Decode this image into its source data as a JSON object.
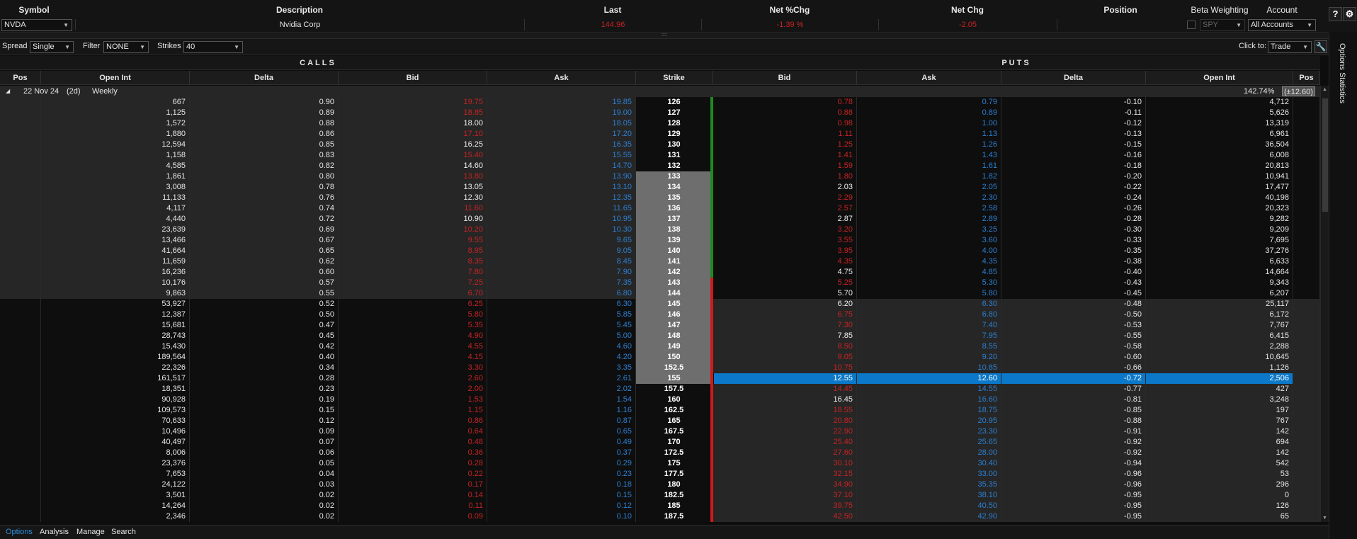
{
  "quote": {
    "headers": {
      "symbol": "Symbol",
      "description": "Description",
      "last": "Last",
      "net_pct": "Net %Chg",
      "net_chg": "Net Chg",
      "position": "Position",
      "beta": "Beta Weighting",
      "account": "Account"
    },
    "symbol": "NVDA",
    "description": "Nvidia Corp",
    "last": "144.96",
    "net_pct": "-1.39 %",
    "net_chg": "-2.05",
    "position": "",
    "beta_symbol": "SPY",
    "account": "All Accounts"
  },
  "buttons": {
    "help": "?",
    "settings": "⚙"
  },
  "splitter": "::::",
  "controls": {
    "spread_label": "Spread",
    "spread_value": "Single",
    "filter_label": "Filter",
    "filter_value": "NONE",
    "strikes_label": "Strikes",
    "strikes_value": "40",
    "clickto_label": "Click to:",
    "clickto_value": "Trade"
  },
  "sections": {
    "calls": "CALLS",
    "puts": "PUTS"
  },
  "columns": {
    "pos": "Pos",
    "open_int": "Open Int",
    "delta": "Delta",
    "bid": "Bid",
    "ask": "Ask",
    "strike": "Strike",
    "p_bid": "Bid",
    "p_ask": "Ask",
    "p_delta": "Delta",
    "p_open_int": "Open Int",
    "p_pos": "Pos"
  },
  "expiration": {
    "date": "22 Nov 24",
    "days": "(2d)",
    "type": "Weekly",
    "iv": "142.74%",
    "move": "(±12.60)"
  },
  "colors": {
    "call_bid_red": "#c62323",
    "ask_blue": "#2c7fd0",
    "selected_row": "#0b78c9",
    "itm_bg": "#1e1e1e"
  },
  "rows": [
    {
      "coi": "667",
      "cdelta": "0.90",
      "cbid": "19.75",
      "cbidc": "red",
      "cask": "19.85",
      "strike": "126",
      "pbid": "0.78",
      "pbidc": "red",
      "pask": "0.79",
      "pdelta": "-0.10",
      "poi": "4,712"
    },
    {
      "coi": "1,125",
      "cdelta": "0.89",
      "cbid": "18.85",
      "cbidc": "red",
      "cask": "19.00",
      "strike": "127",
      "pbid": "0.88",
      "pbidc": "red",
      "pask": "0.89",
      "pdelta": "-0.11",
      "poi": "5,626"
    },
    {
      "coi": "1,572",
      "cdelta": "0.88",
      "cbid": "18.00",
      "cbidc": "white",
      "cask": "18.05",
      "strike": "128",
      "pbid": "0.98",
      "pbidc": "red",
      "pask": "1.00",
      "pdelta": "-0.12",
      "poi": "13,319"
    },
    {
      "coi": "1,880",
      "cdelta": "0.86",
      "cbid": "17.10",
      "cbidc": "red",
      "cask": "17.20",
      "strike": "129",
      "pbid": "1.11",
      "pbidc": "red",
      "pask": "1.13",
      "pdelta": "-0.13",
      "poi": "6,961"
    },
    {
      "coi": "12,594",
      "cdelta": "0.85",
      "cbid": "16.25",
      "cbidc": "white",
      "cask": "16.35",
      "strike": "130",
      "pbid": "1.25",
      "pbidc": "red",
      "pask": "1.26",
      "pdelta": "-0.15",
      "poi": "36,504"
    },
    {
      "coi": "1,158",
      "cdelta": "0.83",
      "cbid": "15.40",
      "cbidc": "red",
      "cask": "15.55",
      "strike": "131",
      "pbid": "1.41",
      "pbidc": "red",
      "pask": "1.43",
      "pdelta": "-0.16",
      "poi": "6,008"
    },
    {
      "coi": "4,585",
      "cdelta": "0.82",
      "cbid": "14.60",
      "cbidc": "white",
      "cask": "14.70",
      "strike": "132",
      "pbid": "1.59",
      "pbidc": "red",
      "pask": "1.61",
      "pdelta": "-0.18",
      "poi": "20,813"
    },
    {
      "coi": "1,861",
      "cdelta": "0.80",
      "cbid": "13.80",
      "cbidc": "red",
      "cask": "13.90",
      "strike": "133",
      "pbid": "1.80",
      "pbidc": "red",
      "pask": "1.82",
      "pdelta": "-0.20",
      "poi": "10,941"
    },
    {
      "coi": "3,008",
      "cdelta": "0.78",
      "cbid": "13.05",
      "cbidc": "white",
      "cask": "13.10",
      "strike": "134",
      "pbid": "2.03",
      "pbidc": "white",
      "pask": "2.05",
      "pdelta": "-0.22",
      "poi": "17,477"
    },
    {
      "coi": "11,133",
      "cdelta": "0.76",
      "cbid": "12.30",
      "cbidc": "white",
      "cask": "12.35",
      "strike": "135",
      "pbid": "2.29",
      "pbidc": "red",
      "pask": "2.30",
      "pdelta": "-0.24",
      "poi": "40,198"
    },
    {
      "coi": "4,117",
      "cdelta": "0.74",
      "cbid": "11.60",
      "cbidc": "red",
      "cask": "11.65",
      "strike": "136",
      "pbid": "2.57",
      "pbidc": "red",
      "pask": "2.58",
      "pdelta": "-0.26",
      "poi": "20,323"
    },
    {
      "coi": "4,440",
      "cdelta": "0.72",
      "cbid": "10.90",
      "cbidc": "white",
      "cask": "10.95",
      "strike": "137",
      "pbid": "2.87",
      "pbidc": "white",
      "pask": "2.89",
      "pdelta": "-0.28",
      "poi": "9,282"
    },
    {
      "coi": "23,639",
      "cdelta": "0.69",
      "cbid": "10.20",
      "cbidc": "red",
      "cask": "10.30",
      "strike": "138",
      "pbid": "3.20",
      "pbidc": "red",
      "pask": "3.25",
      "pdelta": "-0.30",
      "poi": "9,209"
    },
    {
      "coi": "13,466",
      "cdelta": "0.67",
      "cbid": "9.55",
      "cbidc": "red",
      "cask": "9.65",
      "strike": "139",
      "pbid": "3.55",
      "pbidc": "red",
      "pask": "3.60",
      "pdelta": "-0.33",
      "poi": "7,695"
    },
    {
      "coi": "41,664",
      "cdelta": "0.65",
      "cbid": "8.95",
      "cbidc": "red",
      "cask": "9.05",
      "strike": "140",
      "pbid": "3.95",
      "pbidc": "red",
      "pask": "4.00",
      "pdelta": "-0.35",
      "poi": "37,276"
    },
    {
      "coi": "11,659",
      "cdelta": "0.62",
      "cbid": "8.35",
      "cbidc": "red",
      "cask": "8.45",
      "strike": "141",
      "pbid": "4.35",
      "pbidc": "red",
      "pask": "4.35",
      "pdelta": "-0.38",
      "poi": "6,633"
    },
    {
      "coi": "16,236",
      "cdelta": "0.60",
      "cbid": "7.80",
      "cbidc": "red",
      "cask": "7.90",
      "strike": "142",
      "pbid": "4.75",
      "pbidc": "white",
      "pask": "4.85",
      "pdelta": "-0.40",
      "poi": "14,664"
    },
    {
      "coi": "10,176",
      "cdelta": "0.57",
      "cbid": "7.25",
      "cbidc": "red",
      "cask": "7.35",
      "strike": "143",
      "pbid": "5.25",
      "pbidc": "red",
      "pask": "5.30",
      "pdelta": "-0.43",
      "poi": "9,343"
    },
    {
      "coi": "9,863",
      "cdelta": "0.55",
      "cbid": "6.70",
      "cbidc": "red",
      "cask": "6.80",
      "strike": "144",
      "pbid": "5.70",
      "pbidc": "white",
      "pask": "5.80",
      "pdelta": "-0.45",
      "poi": "6,207"
    },
    {
      "coi": "53,927",
      "cdelta": "0.52",
      "cbid": "6.25",
      "cbidc": "red",
      "cask": "6.30",
      "strike": "145",
      "pbid": "6.20",
      "pbidc": "white",
      "pask": "6.30",
      "pdelta": "-0.48",
      "poi": "25,117"
    },
    {
      "coi": "12,387",
      "cdelta": "0.50",
      "cbid": "5.80",
      "cbidc": "red",
      "cask": "5.85",
      "strike": "146",
      "pbid": "6.75",
      "pbidc": "red",
      "pask": "6.80",
      "pdelta": "-0.50",
      "poi": "6,172"
    },
    {
      "coi": "15,681",
      "cdelta": "0.47",
      "cbid": "5.35",
      "cbidc": "red",
      "cask": "5.45",
      "strike": "147",
      "pbid": "7.30",
      "pbidc": "red",
      "pask": "7.40",
      "pdelta": "-0.53",
      "poi": "7,767"
    },
    {
      "coi": "28,743",
      "cdelta": "0.45",
      "cbid": "4.90",
      "cbidc": "red",
      "cask": "5.00",
      "strike": "148",
      "pbid": "7.85",
      "pbidc": "white",
      "pask": "7.95",
      "pdelta": "-0.55",
      "poi": "6,415"
    },
    {
      "coi": "15,430",
      "cdelta": "0.42",
      "cbid": "4.55",
      "cbidc": "red",
      "cask": "4.60",
      "strike": "149",
      "pbid": "8.50",
      "pbidc": "red",
      "pask": "8.55",
      "pdelta": "-0.58",
      "poi": "2,288"
    },
    {
      "coi": "189,564",
      "cdelta": "0.40",
      "cbid": "4.15",
      "cbidc": "red",
      "cask": "4.20",
      "strike": "150",
      "pbid": "9.05",
      "pbidc": "red",
      "pask": "9.20",
      "pdelta": "-0.60",
      "poi": "10,645"
    },
    {
      "coi": "22,326",
      "cdelta": "0.34",
      "cbid": "3.30",
      "cbidc": "red",
      "cask": "3.35",
      "strike": "152.5",
      "pbid": "10.75",
      "pbidc": "red",
      "pask": "10.85",
      "pdelta": "-0.66",
      "poi": "1,126"
    },
    {
      "coi": "161,517",
      "cdelta": "0.28",
      "cbid": "2.60",
      "cbidc": "red",
      "cask": "2.61",
      "strike": "155",
      "pbid": "12.55",
      "pbidc": "white",
      "pask": "12.60",
      "pdelta": "-0.72",
      "poi": "2,506",
      "selected": true
    },
    {
      "coi": "18,351",
      "cdelta": "0.23",
      "cbid": "2.00",
      "cbidc": "red",
      "cask": "2.02",
      "strike": "157.5",
      "pbid": "14.45",
      "pbidc": "red",
      "pask": "14.55",
      "pdelta": "-0.77",
      "poi": "427"
    },
    {
      "coi": "90,928",
      "cdelta": "0.19",
      "cbid": "1.53",
      "cbidc": "red",
      "cask": "1.54",
      "strike": "160",
      "pbid": "16.45",
      "pbidc": "white",
      "pask": "16.60",
      "pdelta": "-0.81",
      "poi": "3,248"
    },
    {
      "coi": "109,573",
      "cdelta": "0.15",
      "cbid": "1.15",
      "cbidc": "red",
      "cask": "1.16",
      "strike": "162.5",
      "pbid": "18.55",
      "pbidc": "red",
      "pask": "18.75",
      "pdelta": "-0.85",
      "poi": "197"
    },
    {
      "coi": "70,633",
      "cdelta": "0.12",
      "cbid": "0.86",
      "cbidc": "red",
      "cask": "0.87",
      "strike": "165",
      "pbid": "20.80",
      "pbidc": "red",
      "pask": "20.95",
      "pdelta": "-0.88",
      "poi": "767"
    },
    {
      "coi": "10,496",
      "cdelta": "0.09",
      "cbid": "0.64",
      "cbidc": "red",
      "cask": "0.65",
      "strike": "167.5",
      "pbid": "22.90",
      "pbidc": "red",
      "pask": "23.30",
      "pdelta": "-0.91",
      "poi": "142"
    },
    {
      "coi": "40,497",
      "cdelta": "0.07",
      "cbid": "0.48",
      "cbidc": "red",
      "cask": "0.49",
      "strike": "170",
      "pbid": "25.40",
      "pbidc": "red",
      "pask": "25.65",
      "pdelta": "-0.92",
      "poi": "694"
    },
    {
      "coi": "8,006",
      "cdelta": "0.06",
      "cbid": "0.36",
      "cbidc": "red",
      "cask": "0.37",
      "strike": "172.5",
      "pbid": "27.60",
      "pbidc": "red",
      "pask": "28.00",
      "pdelta": "-0.92",
      "poi": "142"
    },
    {
      "coi": "23,376",
      "cdelta": "0.05",
      "cbid": "0.28",
      "cbidc": "red",
      "cask": "0.29",
      "strike": "175",
      "pbid": "30.10",
      "pbidc": "red",
      "pask": "30.40",
      "pdelta": "-0.94",
      "poi": "542"
    },
    {
      "coi": "7,653",
      "cdelta": "0.04",
      "cbid": "0.22",
      "cbidc": "red",
      "cask": "0.23",
      "strike": "177.5",
      "pbid": "32.15",
      "pbidc": "red",
      "pask": "33.00",
      "pdelta": "-0.96",
      "poi": "53"
    },
    {
      "coi": "24,122",
      "cdelta": "0.03",
      "cbid": "0.17",
      "cbidc": "red",
      "cask": "0.18",
      "strike": "180",
      "pbid": "34.90",
      "pbidc": "red",
      "pask": "35.35",
      "pdelta": "-0.96",
      "poi": "296"
    },
    {
      "coi": "3,501",
      "cdelta": "0.02",
      "cbid": "0.14",
      "cbidc": "red",
      "cask": "0.15",
      "strike": "182.5",
      "pbid": "37.10",
      "pbidc": "red",
      "pask": "38.10",
      "pdelta": "-0.95",
      "poi": "0"
    },
    {
      "coi": "14,264",
      "cdelta": "0.02",
      "cbid": "0.11",
      "cbidc": "red",
      "cask": "0.12",
      "strike": "185",
      "pbid": "39.75",
      "pbidc": "red",
      "pask": "40.50",
      "pdelta": "-0.95",
      "poi": "126"
    },
    {
      "coi": "2,346",
      "cdelta": "0.02",
      "cbid": "0.09",
      "cbidc": "red",
      "cask": "0.10",
      "strike": "187.5",
      "pbid": "42.50",
      "pbidc": "red",
      "pask": "42.90",
      "pdelta": "-0.95",
      "poi": "65"
    }
  ],
  "tabs": [
    "Options",
    "Analysis",
    "Manage",
    "Search"
  ],
  "side_panel": "Options Statistics"
}
